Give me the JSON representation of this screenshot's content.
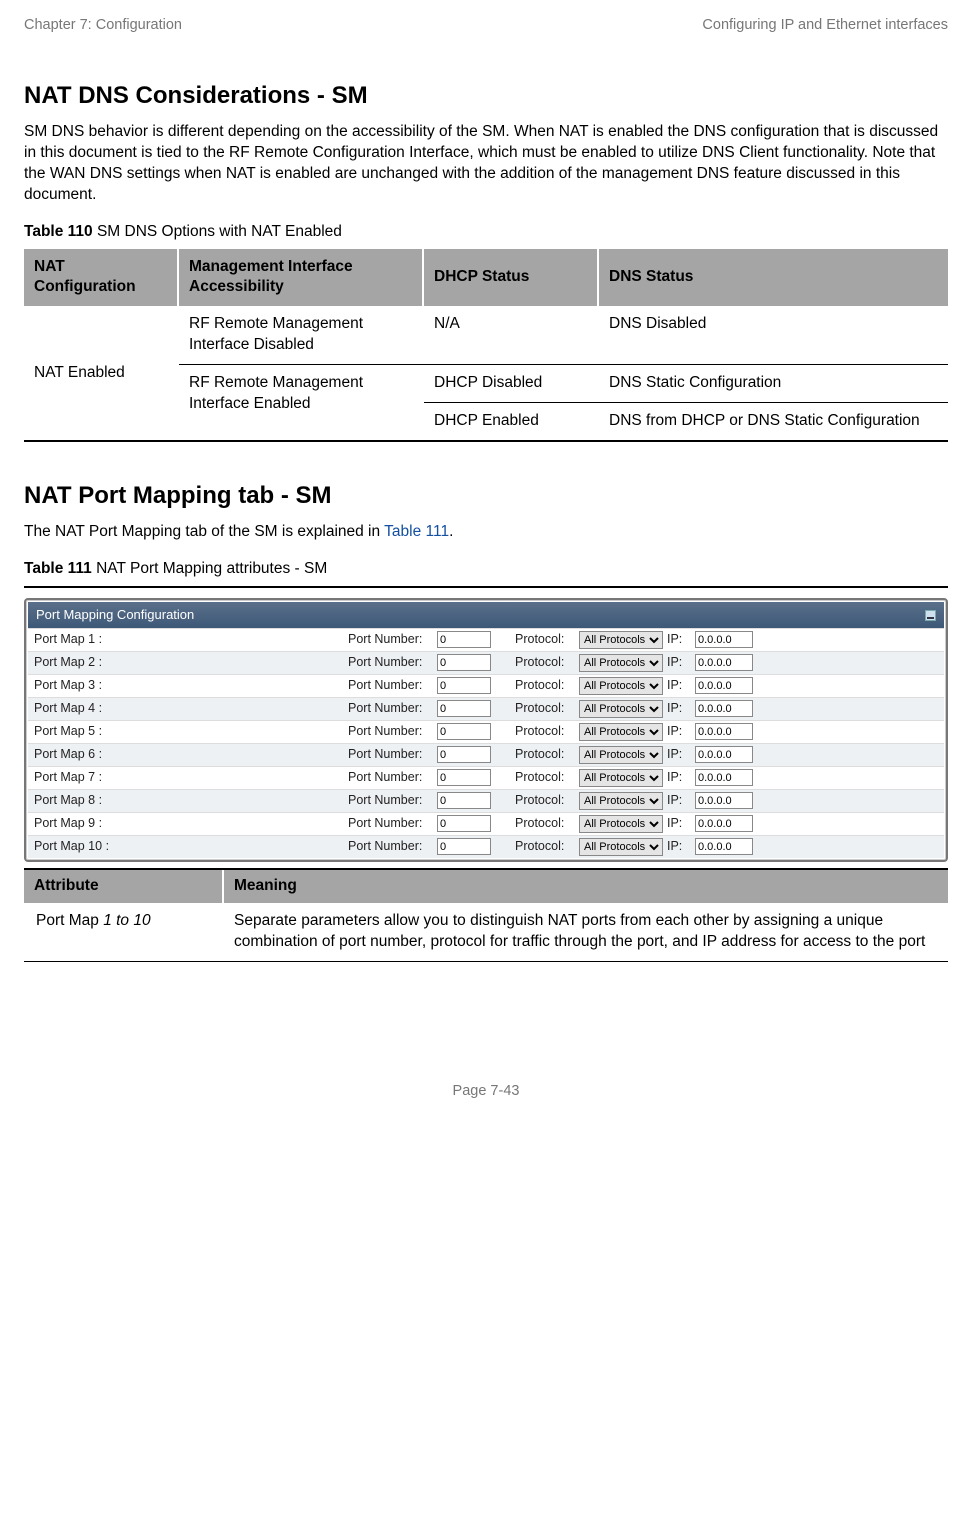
{
  "header": {
    "left": "Chapter 7:  Configuration",
    "right": "Configuring IP and Ethernet interfaces"
  },
  "section1": {
    "title": "NAT DNS Considerations - SM",
    "body": "SM DNS behavior is different depending on the accessibility of the SM. When NAT is enabled the DNS configuration that is discussed in this document is tied to the RF Remote Configuration Interface, which must be enabled to utilize DNS Client functionality. Note that the WAN DNS settings when NAT is enabled are unchanged with the addition of the management DNS feature discussed in this document.",
    "table_caption_bold": "Table 110",
    "table_caption_rest": " SM DNS Options with NAT Enabled",
    "table": {
      "headers": [
        "NAT Configuration",
        "Management Interface Accessibility",
        "DHCP Status",
        "DNS Status"
      ],
      "col1": "NAT Enabled",
      "row1": {
        "mgmt": "RF Remote Management Interface Disabled",
        "dhcp": "N/A",
        "dns": "DNS Disabled"
      },
      "row2_mgmt": "RF Remote Management Interface Enabled",
      "row2": {
        "dhcp": "DHCP Disabled",
        "dns": "DNS Static Configuration"
      },
      "row3": {
        "dhcp": "DHCP Enabled",
        "dns": "DNS from DHCP or DNS Static Configuration"
      }
    }
  },
  "section2": {
    "title": "NAT Port Mapping tab - SM",
    "body_pre": "The NAT Port Mapping tab of the SM is explained in ",
    "body_link": "Table 111",
    "body_post": ".",
    "table_caption_bold": "Table 111",
    "table_caption_rest": " NAT Port Mapping attributes - SM",
    "figure": {
      "panel_title": "Port Mapping Configuration",
      "labels": {
        "port_number": "Port Number:",
        "protocol": "Protocol:",
        "ip": "IP:"
      },
      "protocol_option": "All Protocols",
      "rows": [
        {
          "name": "Port Map 1 :",
          "port": "0",
          "ip": "0.0.0.0"
        },
        {
          "name": "Port Map 2 :",
          "port": "0",
          "ip": "0.0.0.0"
        },
        {
          "name": "Port Map 3 :",
          "port": "0",
          "ip": "0.0.0.0"
        },
        {
          "name": "Port Map 4 :",
          "port": "0",
          "ip": "0.0.0.0"
        },
        {
          "name": "Port Map 5 :",
          "port": "0",
          "ip": "0.0.0.0"
        },
        {
          "name": "Port Map 6 :",
          "port": "0",
          "ip": "0.0.0.0"
        },
        {
          "name": "Port Map 7 :",
          "port": "0",
          "ip": "0.0.0.0"
        },
        {
          "name": "Port Map 8 :",
          "port": "0",
          "ip": "0.0.0.0"
        },
        {
          "name": "Port Map 9 :",
          "port": "0",
          "ip": "0.0.0.0"
        },
        {
          "name": "Port Map 10 :",
          "port": "0",
          "ip": "0.0.0.0"
        }
      ]
    },
    "attr_table": {
      "headers": [
        "Attribute",
        "Meaning"
      ],
      "row": {
        "attr_pre": "Port Map ",
        "attr_em": "1 to 10",
        "meaning": "Separate parameters allow you to distinguish NAT ports from each other by assigning a unique combination of port number, protocol for traffic through the port, and IP address for access to the port"
      }
    }
  },
  "footer": {
    "text": "Page 7-43"
  }
}
